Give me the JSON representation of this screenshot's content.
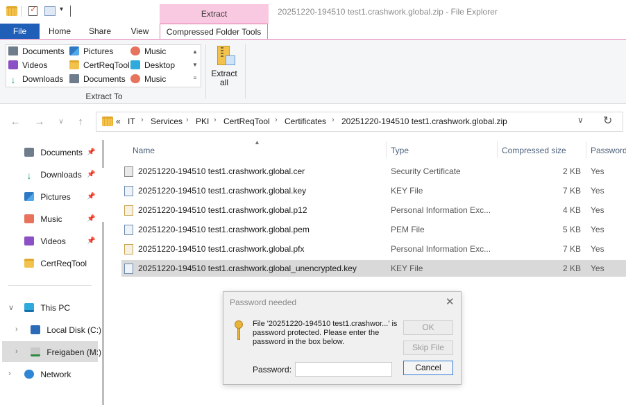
{
  "window": {
    "title": "20251220-194510 test1.crashwork.global.zip - File Explorer",
    "context_tab_group": "Extract"
  },
  "ribbon": {
    "tabs": [
      {
        "label": "File"
      },
      {
        "label": "Home"
      },
      {
        "label": "Share"
      },
      {
        "label": "View"
      },
      {
        "label": "Compressed Folder Tools"
      }
    ],
    "extract_to": {
      "group_label": "Extract To",
      "items": [
        {
          "label": "Documents",
          "icon": "documents-icon"
        },
        {
          "label": "Pictures",
          "icon": "pictures-icon"
        },
        {
          "label": "Music",
          "icon": "music-icon"
        },
        {
          "label": "Videos",
          "icon": "videos-icon"
        },
        {
          "label": "CertReqTool",
          "icon": "folder-icon"
        },
        {
          "label": "Desktop",
          "icon": "desktop-icon"
        },
        {
          "label": "Downloads",
          "icon": "downloads-icon"
        },
        {
          "label": "Documents",
          "icon": "documents-icon"
        },
        {
          "label": "Music",
          "icon": "music-icon"
        }
      ]
    },
    "extract_all": {
      "line1": "Extract",
      "line2": "all"
    }
  },
  "address": {
    "overflow": "«",
    "crumbs": [
      "IT",
      "Services",
      "PKI",
      "CertReqTool",
      "Certificates",
      "20251220-194510 test1.crashwork.global.zip"
    ],
    "separator": "›"
  },
  "nav": {
    "quick_access": [
      {
        "label": "Documents",
        "icon": "documents-icon",
        "pinned": true
      },
      {
        "label": "Downloads",
        "icon": "downloads-icon",
        "pinned": true
      },
      {
        "label": "Pictures",
        "icon": "pictures-icon",
        "pinned": true
      },
      {
        "label": "Music",
        "icon": "music-icon",
        "pinned": true
      },
      {
        "label": "Videos",
        "icon": "videos-icon",
        "pinned": true
      },
      {
        "label": "CertReqTool",
        "icon": "folder-icon",
        "pinned": false
      }
    ],
    "this_pc": "This PC",
    "drives": [
      {
        "label": "Local Disk (C:)"
      },
      {
        "label": "Freigaben (M:)"
      }
    ],
    "network": "Network"
  },
  "files": {
    "columns": {
      "name": "Name",
      "type": "Type",
      "size": "Compressed size",
      "password": "Password"
    },
    "rows": [
      {
        "name": "20251220-194510 test1.crashwork.global.cer",
        "type": "Security Certificate",
        "size": "2 KB",
        "password": "Yes",
        "icon": "certificate-file-icon"
      },
      {
        "name": "20251220-194510 test1.crashwork.global.key",
        "type": "KEY File",
        "size": "7 KB",
        "password": "Yes",
        "icon": "key-file-icon"
      },
      {
        "name": "20251220-194510 test1.crashwork.global.p12",
        "type": "Personal Information Exc...",
        "size": "4 KB",
        "password": "Yes",
        "icon": "personal-info-file-icon"
      },
      {
        "name": "20251220-194510 test1.crashwork.global.pem",
        "type": "PEM File",
        "size": "5 KB",
        "password": "Yes",
        "icon": "pem-file-icon"
      },
      {
        "name": "20251220-194510 test1.crashwork.global.pfx",
        "type": "Personal Information Exc...",
        "size": "7 KB",
        "password": "Yes",
        "icon": "personal-info-file-icon"
      },
      {
        "name": "20251220-194510 test1.crashwork.global_unencrypted.key",
        "type": "KEY File",
        "size": "2 KB",
        "password": "Yes",
        "icon": "key-file-icon"
      }
    ]
  },
  "dialog": {
    "title": "Password needed",
    "message": "File '20251220-194510 test1.crashwor...' is password protected.  Please enter the password in the box below.",
    "ok": "OK",
    "skip": "Skip File",
    "cancel": "Cancel",
    "password_label": "Password:",
    "password_value": ""
  },
  "colors": {
    "accent": "#1f5fb8",
    "context_tab": "#f9c9e1",
    "selection": "#d9d9d9"
  }
}
